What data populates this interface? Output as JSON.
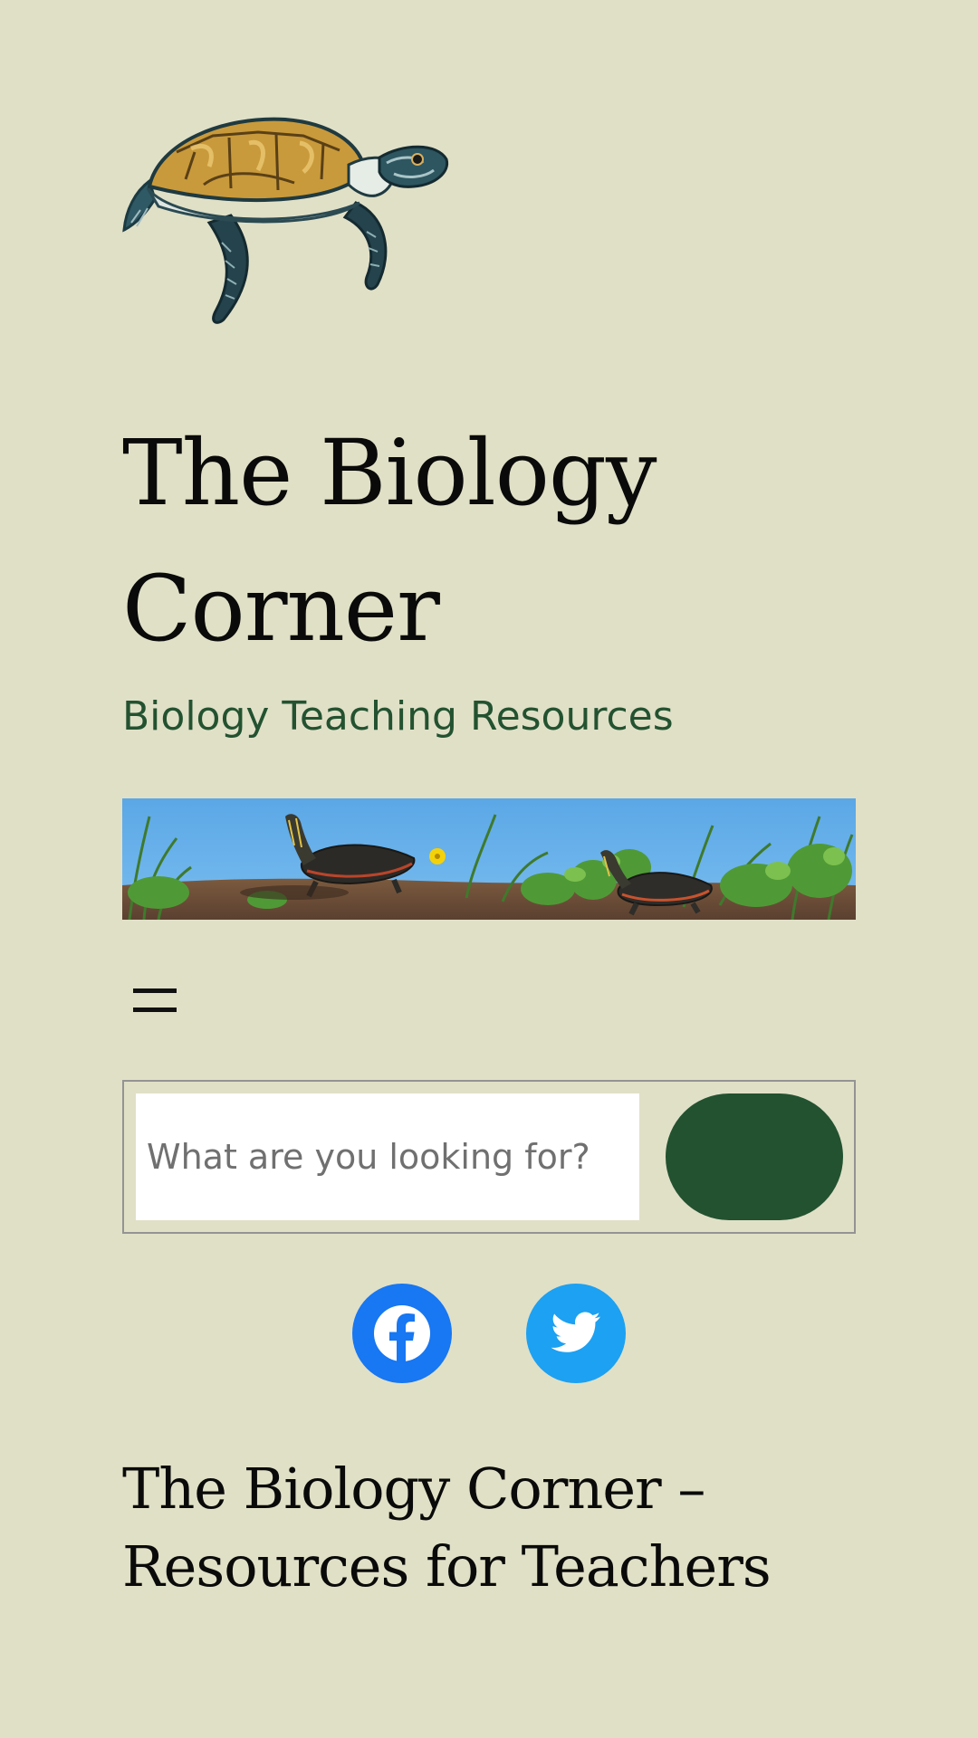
{
  "site": {
    "title": "The Biology Corner",
    "tagline": "Biology Teaching Resources"
  },
  "header": {
    "logo_icon": "sea-turtle-logo",
    "banner_image": "painted-turtles-basking-banner",
    "menu_icon": "hamburger-menu-icon"
  },
  "search": {
    "placeholder": "What are you looking for?",
    "value": "",
    "button_color": "#235230"
  },
  "social": {
    "items": [
      {
        "name": "Facebook",
        "icon": "facebook-icon",
        "color": "#1877f2"
      },
      {
        "name": "Twitter",
        "icon": "twitter-icon",
        "color": "#1da1f2"
      }
    ]
  },
  "main": {
    "heading": "The Biology Corner – Resources for Teachers"
  },
  "colors": {
    "background": "#e0e0c7",
    "accent_green": "#235230"
  }
}
